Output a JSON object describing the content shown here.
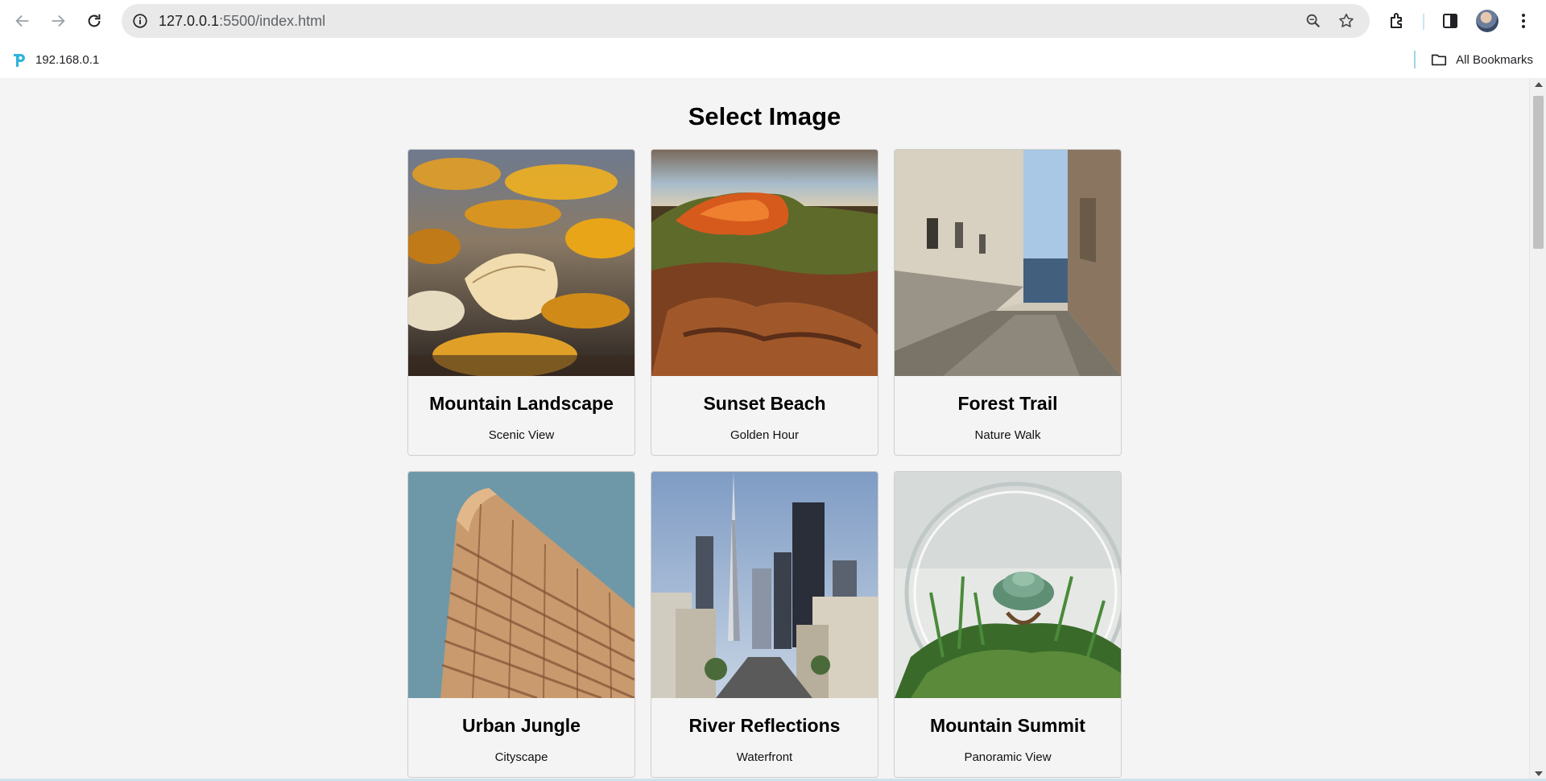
{
  "browser": {
    "url_host": "127.0.0.1",
    "url_path": ":5500/index.html",
    "bookmark": {
      "label": "192.168.0.1",
      "icon": "tp-link-icon"
    },
    "all_bookmarks_label": "All Bookmarks",
    "icons": [
      "back-arrow-icon",
      "forward-arrow-icon",
      "reload-icon",
      "site-info-icon",
      "zoom-icon",
      "star-icon",
      "extensions-icon",
      "side-panel-icon",
      "profile-avatar",
      "more-menu-icon",
      "folder-icon"
    ]
  },
  "page": {
    "title": "Select Image"
  },
  "cards": [
    {
      "title": "Mountain Landscape",
      "subtitle": "Scenic View",
      "image": "autumn-leaves-photo"
    },
    {
      "title": "Sunset Beach",
      "subtitle": "Golden Hour",
      "image": "red-cliffs-photo"
    },
    {
      "title": "Forest Trail",
      "subtitle": "Nature Walk",
      "image": "alley-sea-photo"
    },
    {
      "title": "Urban Jungle",
      "subtitle": "Cityscape",
      "image": "flatiron-building-photo"
    },
    {
      "title": "River Reflections",
      "subtitle": "Waterfront",
      "image": "city-skyline-photo"
    },
    {
      "title": "Mountain Summit",
      "subtitle": "Panoramic View",
      "image": "terrarium-succulent-photo"
    }
  ],
  "colors": {
    "page_bg": "#f4f4f4",
    "omnibox_bg": "#e9e9e9",
    "card_border": "#cfcfcf",
    "bookmark_accent": "#9fd5ec"
  }
}
